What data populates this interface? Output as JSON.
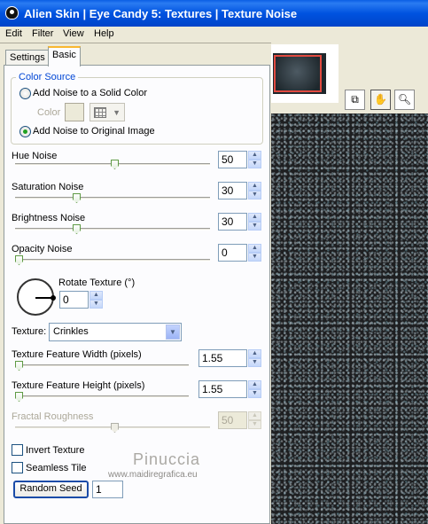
{
  "window": {
    "title": "Alien Skin | Eye Candy 5: Textures | Texture Noise"
  },
  "menu": [
    "Edit",
    "Filter",
    "View",
    "Help"
  ],
  "tabs": {
    "settings": "Settings",
    "basic": "Basic"
  },
  "color_source": {
    "title": "Color Source",
    "option_solid": "Add Noise to a Solid Color",
    "color_label": "Color",
    "option_original": "Add Noise to Original Image",
    "selected": "Add Noise to Original Image"
  },
  "controls": {
    "hue_noise": {
      "label": "Hue Noise",
      "value": "50",
      "slider_fraction": 0.5
    },
    "saturation_noise": {
      "label": "Saturation Noise",
      "value": "30",
      "slider_fraction": 0.3
    },
    "brightness_noise": {
      "label": "Brightness Noise",
      "value": "30",
      "slider_fraction": 0.3
    },
    "opacity_noise": {
      "label": "Opacity Noise",
      "value": "0",
      "slider_fraction": 0.0
    },
    "rotate_texture": {
      "label": "Rotate Texture (°)",
      "value": "0"
    },
    "texture": {
      "label": "Texture:",
      "value": "Crinkles"
    },
    "feature_width": {
      "label": "Texture Feature Width (pixels)",
      "value": "1.55",
      "slider_fraction": 0.0
    },
    "feature_height": {
      "label": "Texture Feature Height (pixels)",
      "value": "1.55",
      "slider_fraction": 0.0
    },
    "fractal_roughness": {
      "label": "Fractal Roughness",
      "value": "50",
      "slider_fraction": 0.5,
      "disabled": true
    }
  },
  "checkboxes": {
    "invert_texture": "Invert Texture",
    "seamless_tile": "Seamless Tile"
  },
  "random_seed": {
    "button": "Random Seed",
    "value": "1"
  },
  "watermark": {
    "name": "Pinuccia",
    "url": "www.maidiregrafica.eu"
  },
  "tools": [
    "preview-compare-icon",
    "hand-icon",
    "zoom-icon"
  ],
  "colors": {
    "title_bar": "#0054e3",
    "group_title": "#0046d5",
    "radio_dot": "#21a121",
    "nav_frame": "#e14a40"
  }
}
